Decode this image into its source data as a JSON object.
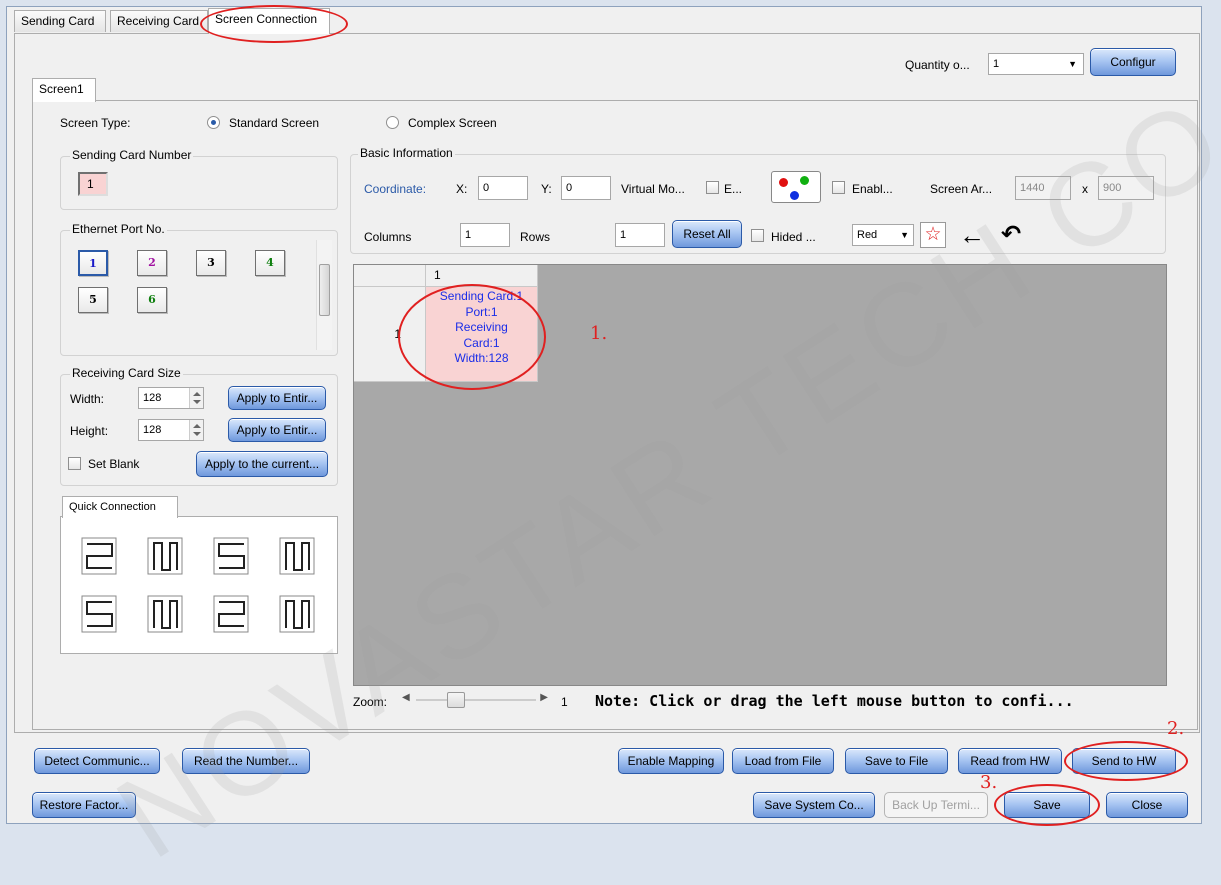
{
  "tabs": [
    "Sending Card",
    "Receiving Card",
    "Screen Connection"
  ],
  "quantity": {
    "label": "Quantity o...",
    "value": "1"
  },
  "configure_label": "Configur",
  "screen_tab": "Screen1",
  "screen_type": {
    "label": "Screen Type:",
    "standard": "Standard Screen",
    "complex": "Complex Screen"
  },
  "sending_card_group": {
    "title": "Sending Card Number",
    "value": "1"
  },
  "ethernet_group": {
    "title": "Ethernet Port No.",
    "ports": [
      "1",
      "2",
      "3",
      "4",
      "5",
      "6"
    ]
  },
  "rc_size": {
    "title": "Receiving Card Size",
    "width_label": "Width:",
    "width_value": "128",
    "height_label": "Height:",
    "height_value": "128",
    "apply_entire_label": "Apply to Entir...",
    "set_blank": "Set Blank",
    "apply_current_label": "Apply to the current..."
  },
  "quick_connection": {
    "title": "Quick Connection"
  },
  "basic_info": {
    "title": "Basic Information",
    "coordinate_label": "Coordinate:",
    "x_label": "X:",
    "x_value": "0",
    "y_label": "Y:",
    "y_value": "0",
    "virtual_label": "Virtual Mo...",
    "e_label": "E...",
    "enable_label": "Enabl...",
    "screen_area_label": "Screen Ar...",
    "screen_w": "1440",
    "screen_x": "x",
    "screen_h": "900",
    "columns_label": "Columns",
    "columns_value": "1",
    "rows_label": "Rows",
    "rows_value": "1",
    "reset_all": "Reset All",
    "hided_label": "Hided ...",
    "color_value": "Red"
  },
  "grid": {
    "col_header": "1",
    "row_header": "1",
    "cell_lines": [
      "Sending Card:1",
      "Port:1",
      "Receiving",
      "Card:1",
      "Width:128"
    ]
  },
  "zoom": {
    "label": "Zoom:",
    "value": "1",
    "note": "Note: Click or drag the left mouse button to confi...",
    "slider_fraction": 0.3
  },
  "bottom_row1": [
    "Detect Communic...",
    "Read the Number...",
    "Enable Mapping",
    "Load from File",
    "Save to File",
    "Read from HW",
    "Send to HW"
  ],
  "bottom_row2": [
    "Restore Factor...",
    "Save System Co...",
    "Back Up Termi...",
    "Save",
    "Close"
  ],
  "annotations": [
    "1.",
    "2.",
    "3."
  ],
  "watermark": "NOVASTAR TECH CO., LTD.",
  "colors": {
    "accent": "#2b5aa8",
    "highlight": "#e02020",
    "cell_text": "#1a2de8",
    "cell_bg": "#f9d3d3"
  }
}
